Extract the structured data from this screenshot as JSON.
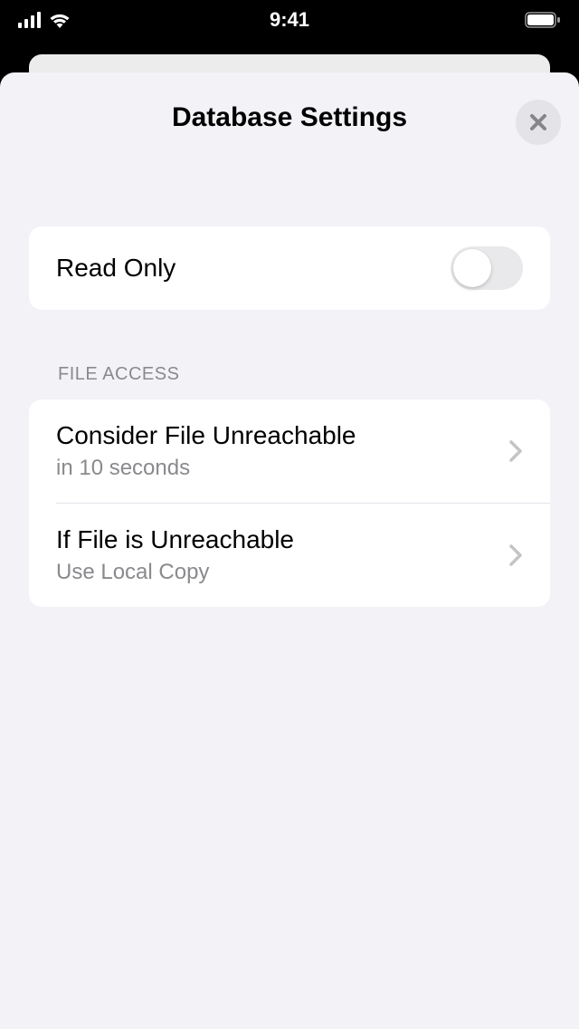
{
  "status": {
    "time": "9:41"
  },
  "sheet": {
    "title": "Database Settings"
  },
  "readonly": {
    "label": "Read Only",
    "value": false
  },
  "fileAccess": {
    "header": "FILE ACCESS",
    "items": [
      {
        "title": "Consider File Unreachable",
        "subtitle": "in 10 seconds"
      },
      {
        "title": "If File is Unreachable",
        "subtitle": "Use Local Copy"
      }
    ]
  }
}
